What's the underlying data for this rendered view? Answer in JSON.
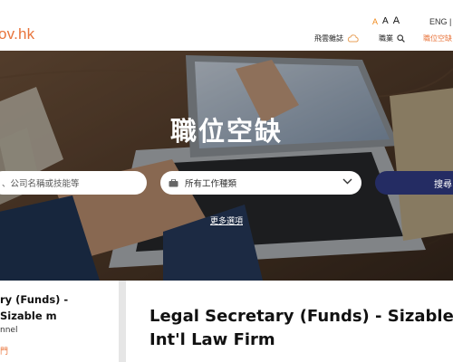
{
  "header": {
    "logo_text": "ov.hk",
    "font_sizes": [
      "A",
      "A",
      "A"
    ],
    "lang": "ENG | 简 |",
    "nav": [
      {
        "label": "飛雲雜誌",
        "icon": "cloud-icon"
      },
      {
        "label": "職業",
        "icon": "search-icon"
      },
      {
        "label": "職位空缺",
        "active": true
      }
    ],
    "accent_color": "#e8743b"
  },
  "hero": {
    "title": "職位空缺",
    "keyword_placeholder": "、公司名稱或技能等",
    "job_type": "所有工作種類",
    "search_button": "搜尋",
    "more_filters": "更多選項"
  },
  "listing": {
    "title": "ry (Funds) - Sizable m",
    "company": "nnel",
    "salary": "門"
  },
  "detail": {
    "title": "Legal Secretary (Funds) - Sizable Int'l Law Firm"
  },
  "colors": {
    "search_button_bg": "#242c63",
    "orange": "#f08a1d"
  }
}
